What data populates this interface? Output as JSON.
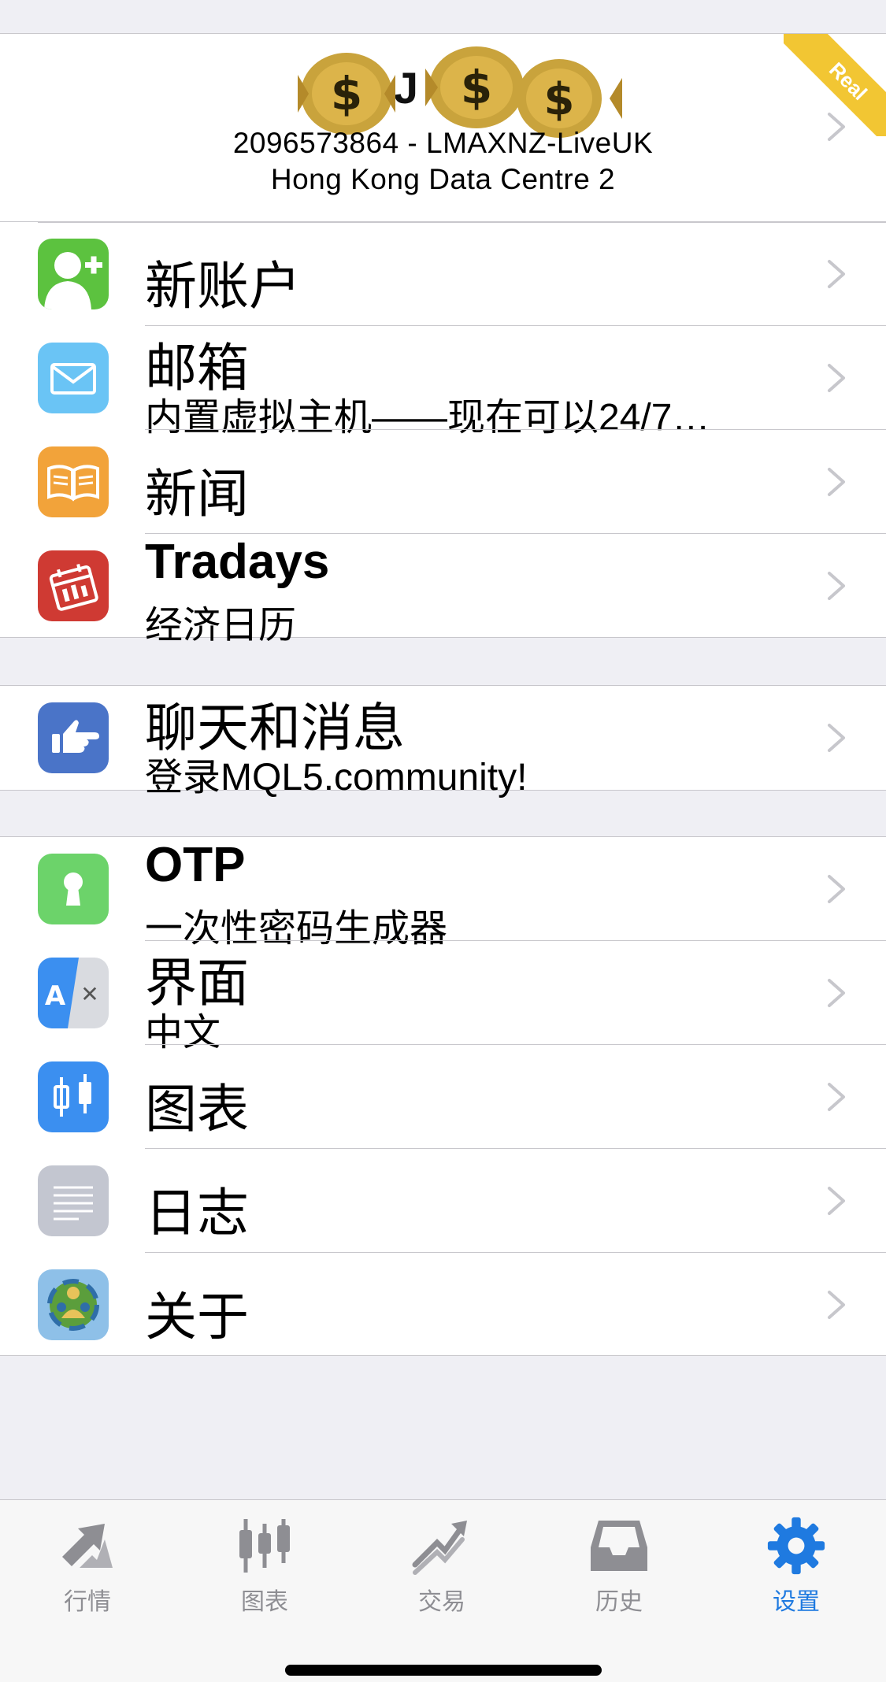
{
  "account": {
    "name": "J   a    r",
    "number_line": "2096573864 - LMAXNZ-LiveUK",
    "server_line": "Hong Kong Data Centre 2",
    "badge": "Real"
  },
  "menu": {
    "new_account": {
      "title": "新账户",
      "icon": "add-user-icon",
      "color": "#5cc23f"
    },
    "mailbox": {
      "title": "邮箱",
      "subtitle": "内置虚拟主机——现在可以24/7…",
      "icon": "envelope-icon",
      "color": "#6ac4f5"
    },
    "news": {
      "title": "新闻",
      "icon": "open-book-icon",
      "color": "#f2a33a"
    },
    "tradays": {
      "title": "Tradays",
      "subtitle": "经济日历",
      "icon": "calendar-icon",
      "color": "#cf3a33"
    },
    "chat": {
      "title": "聊天和消息",
      "subtitle": "登录MQL5.community!",
      "icon": "hand-point-icon",
      "color": "#4a74c8"
    },
    "otp": {
      "title": "OTP",
      "subtitle": "一次性密码生成器",
      "icon": "keyhole-icon",
      "color": "#6cd36a"
    },
    "interface": {
      "title": "界面",
      "subtitle": "中文",
      "icon": "language-icon",
      "color": "#3b8ff0"
    },
    "charts": {
      "title": "图表",
      "icon": "candlestick-icon",
      "color": "#3b8ff0"
    },
    "journal": {
      "title": "日志",
      "icon": "lines-icon",
      "color": "#c3c6d0"
    },
    "about": {
      "title": "关于",
      "icon": "metatrader-logo-icon",
      "color": "#8ec0e8"
    }
  },
  "tabbar": {
    "quotes": "行情",
    "chart": "图表",
    "trade": "交易",
    "history": "历史",
    "settings": "设置"
  },
  "colors": {
    "accent": "#1f7ae0",
    "inactive": "#8e8e93",
    "ribbon": "#f2c633"
  }
}
